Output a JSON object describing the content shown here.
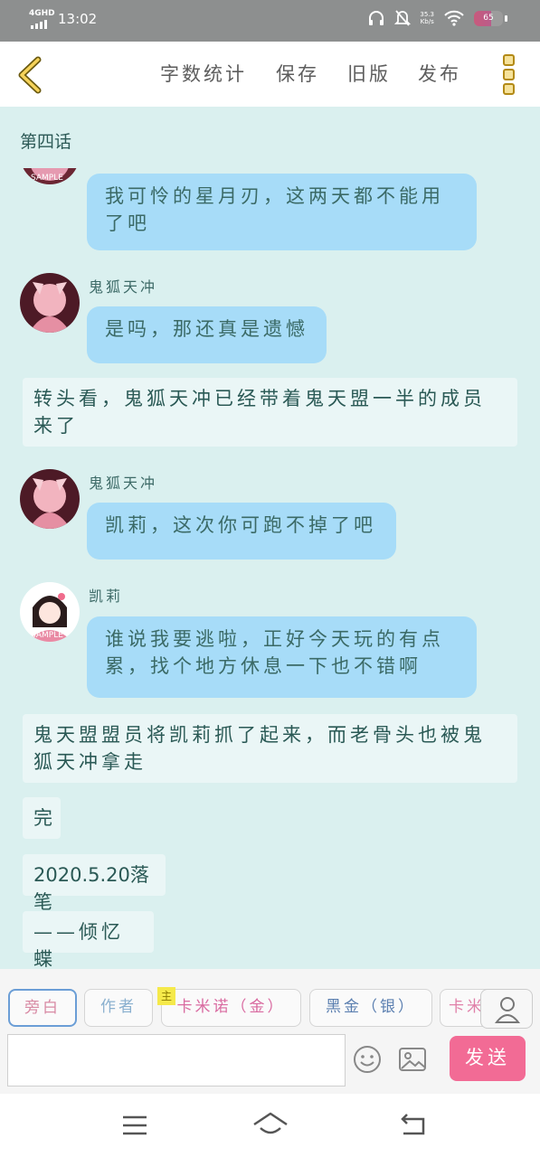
{
  "status_bar": {
    "network": "4GHD",
    "time": "13:02",
    "speed_value": "35.3",
    "speed_unit": "Kb/s",
    "battery": "65"
  },
  "toolbar": {
    "word_count": "字数统计",
    "save": "保存",
    "old_version": "旧版",
    "publish": "发布"
  },
  "chapter_title": "第四话",
  "messages": [
    {
      "type": "bubble",
      "text": "我可怜的星月刃，这两天都不能用了吧"
    },
    {
      "type": "bubble",
      "speaker": "鬼狐天冲",
      "text": "是吗，那还真是遗憾"
    },
    {
      "type": "narration",
      "text": "转头看，鬼狐天冲已经带着鬼天盟一半的成员来了"
    },
    {
      "type": "bubble",
      "speaker": "鬼狐天冲",
      "text": "凯莉，这次你可跑不掉了吧"
    },
    {
      "type": "bubble",
      "speaker": "凯莉",
      "text": "谁说我要逃啦，正好今天玩的有点累，找个地方休息一下也不错啊"
    },
    {
      "type": "narration",
      "text": "鬼天盟盟员将凯莉抓了起来，而老骨头也被鬼狐天冲拿走"
    },
    {
      "type": "narration",
      "text": "完"
    },
    {
      "type": "narration",
      "text": "2020.5.20落笔"
    },
    {
      "type": "narration",
      "text": "——倾忆蝶"
    }
  ],
  "avatar_watermark": "SAMPLE",
  "characters": [
    {
      "label": "旁白",
      "selected": true
    },
    {
      "label": "作者",
      "selected": false
    },
    {
      "label": "卡米诺（金）",
      "badge": "主",
      "selected": false
    },
    {
      "label": "黑金（银）",
      "selected": false
    },
    {
      "label": "卡米",
      "selected": false
    }
  ],
  "input": {
    "value": "",
    "send_label": "发送"
  },
  "colors": {
    "bubble": "#a7dcf8",
    "background": "#daf0ef",
    "send_button": "#f26b95",
    "back_arrow": "#f6d35a"
  }
}
